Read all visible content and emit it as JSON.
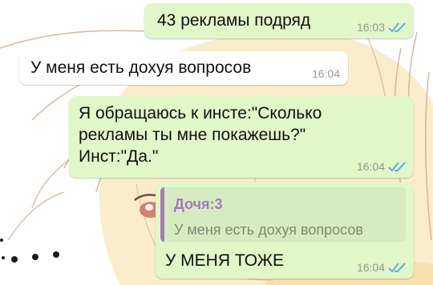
{
  "chat": {
    "wallpaper": {
      "line_color": "#d2a48c",
      "hair_color": "#f6dea1",
      "eye_color": "#c96f63"
    },
    "colors": {
      "outgoing_bubble": "#e0f7c8",
      "incoming_bubble": "#ffffff",
      "read_ticks": "#4fa9e6",
      "reply_accent": "#a977b8"
    },
    "messages": [
      {
        "direction": "outgoing",
        "text": "43 рекламы подряд",
        "time": "16:03",
        "status_icon": "double-check-read-icon"
      },
      {
        "direction": "incoming",
        "text": "У меня есть дохуя вопросов",
        "time": "16:04"
      },
      {
        "direction": "outgoing",
        "text": "Я обращаюсь к инсте:\"Сколько\nрекламы ты мне покажешь?\"\nИнст:\"Да.\"",
        "time": "16:04",
        "status_icon": "double-check-read-icon"
      },
      {
        "direction": "outgoing",
        "reply_to": {
          "author": "Дочя:3",
          "text": "У меня есть дохуя вопросов"
        },
        "text": "У МЕНЯ ТОЖЕ",
        "time": "16:04",
        "status_icon": "double-check-read-icon"
      }
    ]
  }
}
